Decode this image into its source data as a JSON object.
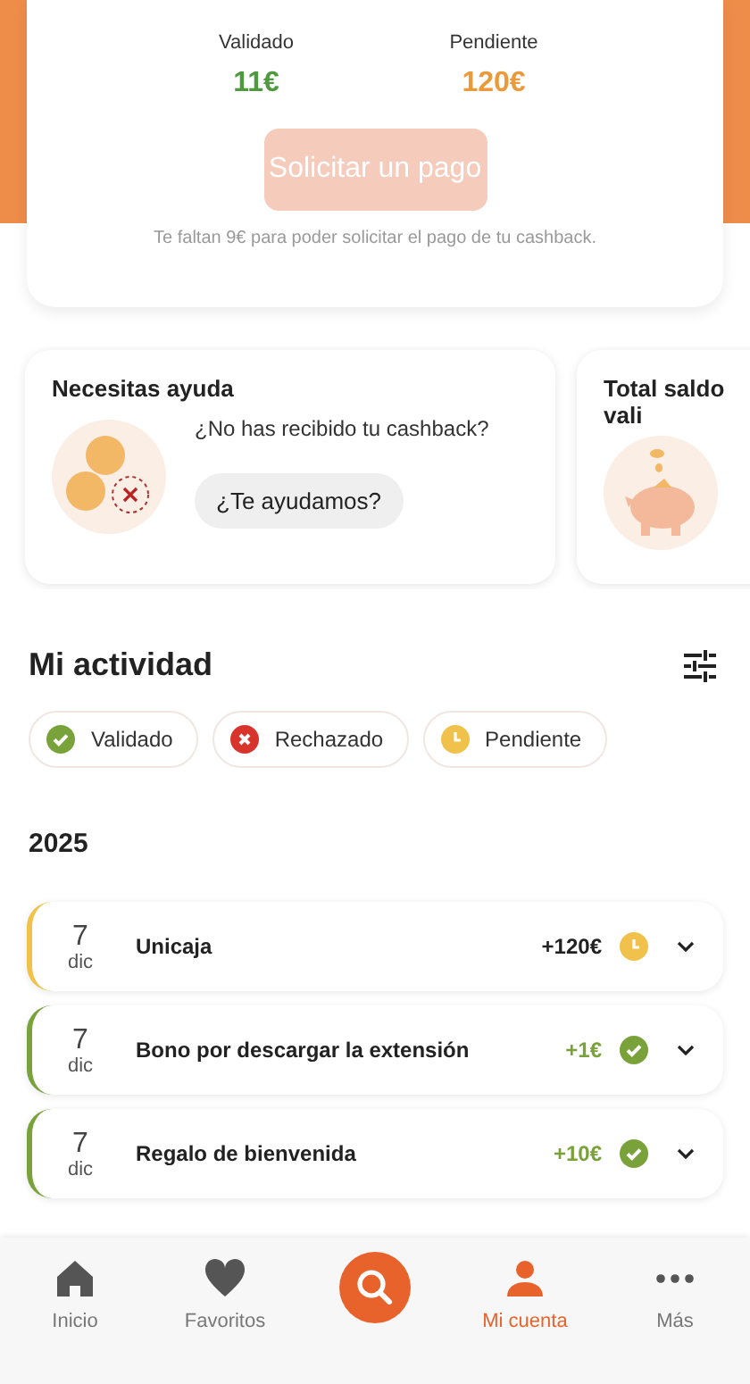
{
  "balance": {
    "items": [
      {
        "label": "Validado",
        "value": "11€",
        "kind": "validated"
      },
      {
        "label": "Pendiente",
        "value": "120€",
        "kind": "pending"
      }
    ],
    "button": {
      "label": "Solicitar un pago",
      "disabled": true
    },
    "note": "Te faltan 9€ para poder solicitar el pago de tu cashback."
  },
  "help_cards": [
    {
      "kind": "help",
      "title": "Necesitas ayuda",
      "text": "¿No has recibido tu cashback?",
      "button": "¿Te ayudamos?"
    },
    {
      "kind": "savings",
      "title": "Total saldo vali"
    }
  ],
  "activity": {
    "title": "Mi actividad",
    "filters": [
      {
        "label": "Validado",
        "kind": "validated"
      },
      {
        "label": "Rechazado",
        "kind": "rejected"
      },
      {
        "label": "Pendiente",
        "kind": "pending"
      }
    ],
    "year": "2025",
    "rows": [
      {
        "day": "7",
        "month": "dic",
        "title": "Unicaja",
        "amount": "+120€",
        "kind": "pending"
      },
      {
        "day": "7",
        "month": "dic",
        "title": "Bono por descargar la extensión",
        "amount": "+1€",
        "kind": "validated"
      },
      {
        "day": "7",
        "month": "dic",
        "title": "Regalo de bienvenida",
        "amount": "+10€",
        "kind": "validated"
      }
    ]
  },
  "nav": [
    {
      "kind": "home",
      "label": "Inicio",
      "selected": false
    },
    {
      "kind": "heart",
      "label": "Favoritos",
      "selected": false
    },
    {
      "kind": "search",
      "selected": false
    },
    {
      "kind": "person",
      "label": "Mi cuenta",
      "selected": true
    },
    {
      "kind": "more",
      "label": "Más",
      "selected": false
    }
  ]
}
